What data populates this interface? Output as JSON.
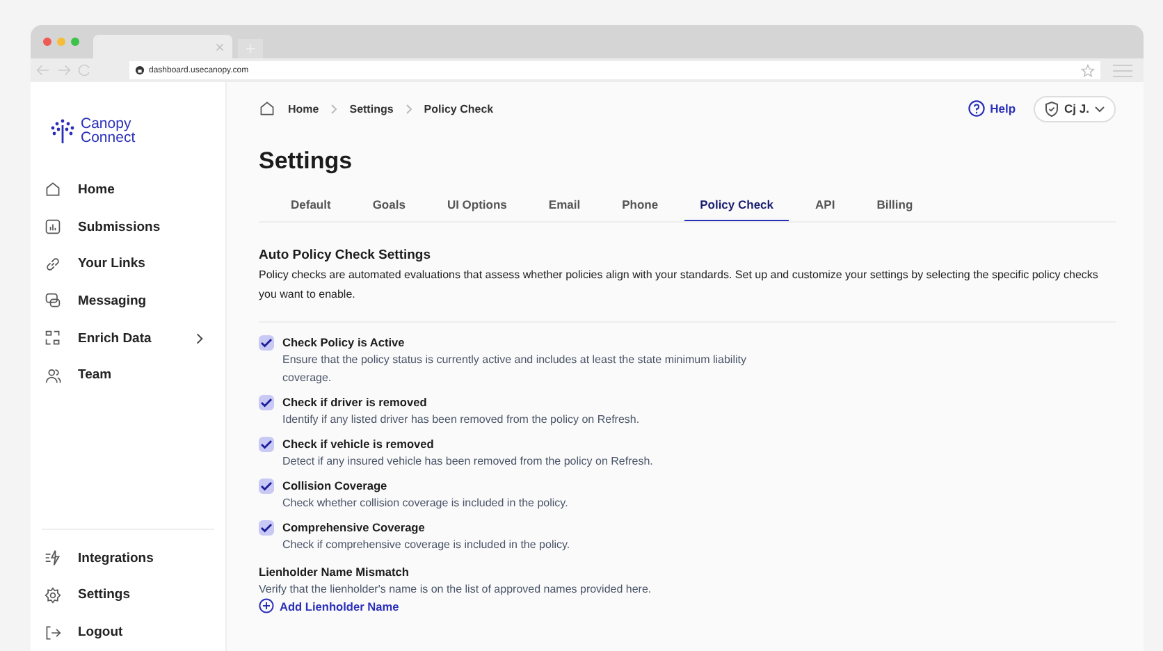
{
  "browser": {
    "url": "dashboard.usecanopy.com"
  },
  "sidebar": {
    "logo": [
      "Canopy",
      "Connect"
    ],
    "items": [
      {
        "label": "Home",
        "kind": "home",
        "expandable": false
      },
      {
        "label": "Submissions",
        "kind": "chart",
        "expandable": false
      },
      {
        "label": "Your Links",
        "kind": "link",
        "expandable": false
      },
      {
        "label": "Messaging",
        "kind": "chat",
        "expandable": false
      },
      {
        "label": "Enrich Data",
        "kind": "data",
        "expandable": true
      },
      {
        "label": "Team",
        "kind": "team",
        "expandable": false
      }
    ],
    "bottom_items": [
      {
        "label": "Integrations",
        "kind": "integrations"
      },
      {
        "label": "Settings",
        "kind": "gear"
      },
      {
        "label": "Logout",
        "kind": "logout"
      }
    ]
  },
  "breadcrumb": [
    "Home",
    "Settings",
    "Policy Check"
  ],
  "header": {
    "help": "Help",
    "user": "Cj J."
  },
  "title": "Settings",
  "tabs": [
    {
      "label": "Default",
      "selected": false
    },
    {
      "label": "Goals",
      "selected": false
    },
    {
      "label": "UI Options",
      "selected": false
    },
    {
      "label": "Email",
      "selected": false
    },
    {
      "label": "Phone",
      "selected": false
    },
    {
      "label": "Policy Check",
      "selected": true
    },
    {
      "label": "API",
      "selected": false
    },
    {
      "label": "Billing",
      "selected": false
    }
  ],
  "section": {
    "title": "Auto Policy Check Settings",
    "description": "Policy checks are automated evaluations that assess whether policies align with your standards. Set up and customize your settings by selecting the specific policy checks you want to enable."
  },
  "checks": [
    {
      "title": "Check Policy is Active",
      "description": "Ensure that the policy status is currently active and includes at least the state minimum liability coverage.",
      "checked": true
    },
    {
      "title": "Check if driver is removed",
      "description": "Identify if any listed driver has been removed from the policy on Refresh.",
      "checked": true
    },
    {
      "title": "Check if vehicle is removed",
      "description": "Detect if any insured vehicle has been removed from the policy on Refresh.",
      "checked": true
    },
    {
      "title": "Collision Coverage",
      "description": "Check whether collision coverage is included in the policy.",
      "checked": true
    },
    {
      "title": "Comprehensive Coverage",
      "description": "Check if comprehensive coverage is included in the policy.",
      "checked": true
    }
  ],
  "lienholder": {
    "title": "Lienholder Name Mismatch",
    "description": "Verify that the lienholder's name is on the list of approved names provided here.",
    "action": "Add Lienholder Name"
  }
}
